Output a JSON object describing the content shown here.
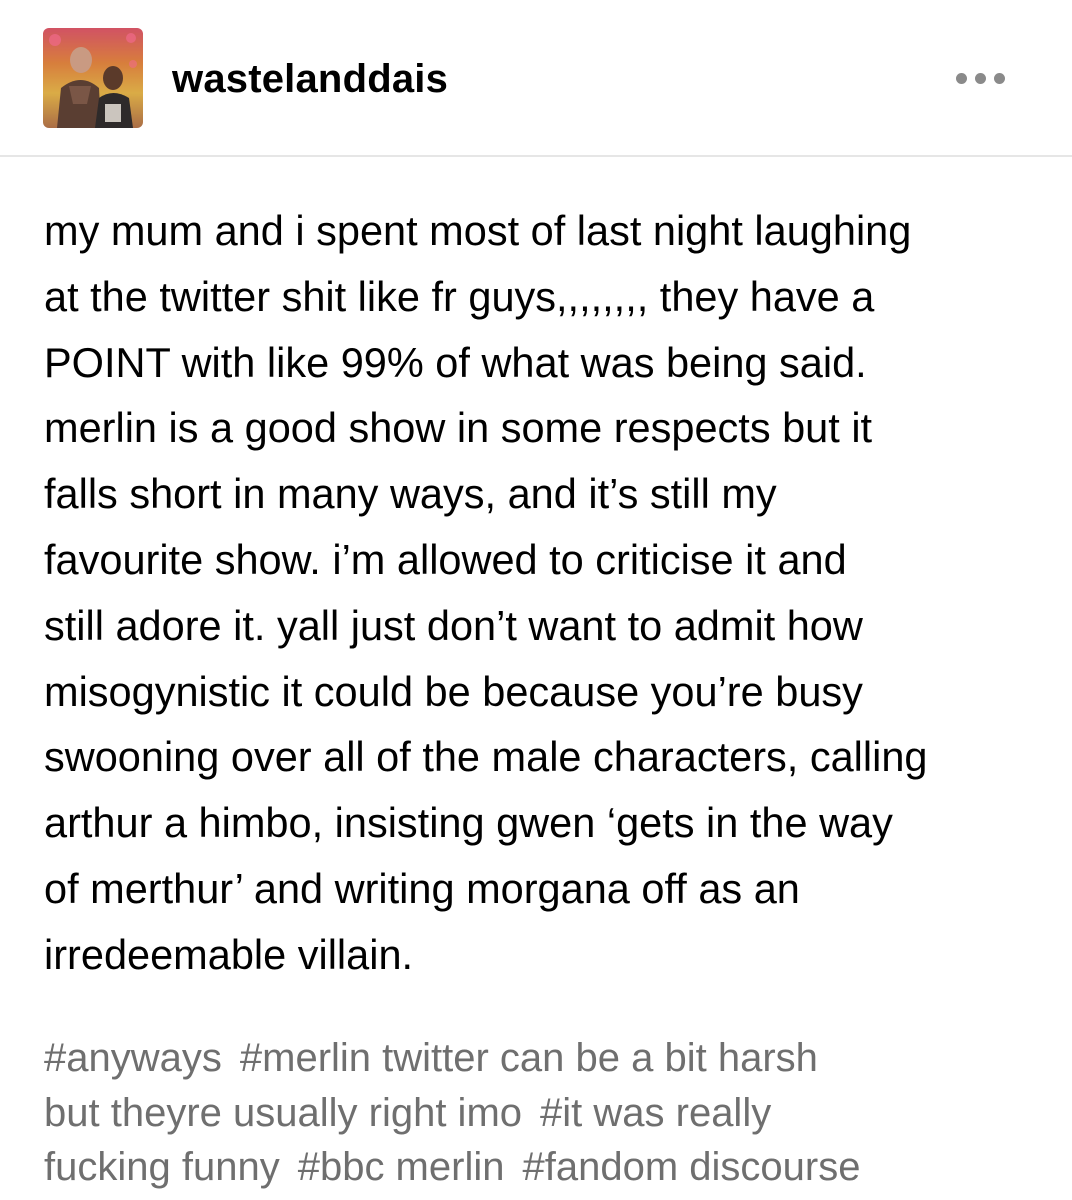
{
  "post": {
    "username": "wastelanddais",
    "more_icon": "ellipsis-icon",
    "avatar_colors": [
      "#e8556e",
      "#f08a3e",
      "#f3d34a",
      "#8a5a3c",
      "#3c2a22"
    ],
    "body_lines": [
      "my mum and i spent most of last night laughing",
      "at the twitter shit like fr guys,,,,,,,, they have a",
      "POINT with like 99% of what was being said.",
      "merlin is a good show in some respects but it",
      "falls short in many ways, and it’s still my",
      "favourite show. i’m allowed to criticise it and",
      "still adore it. yall just don’t want to admit how",
      "misogynistic it could be because you’re busy",
      "swooning over all of the male characters, calling",
      "arthur a himbo, insisting gwen ‘gets in the way",
      "of merthur’ and writing morgana off as an",
      "irredeemable villain."
    ],
    "tags": [
      "#anyways",
      "#merlin twitter can be a bit harsh but theyre usually right imo",
      "#it was really fucking funny",
      "#bbc merlin",
      "#fandom discourse"
    ],
    "tag_lines": [
      [
        "#anyways",
        "#merlin twitter can be a bit harsh"
      ],
      [
        "but theyre usually right imo",
        "#it was really"
      ],
      [
        "fucking funny",
        "#bbc merlin",
        "#fandom discourse"
      ]
    ]
  }
}
